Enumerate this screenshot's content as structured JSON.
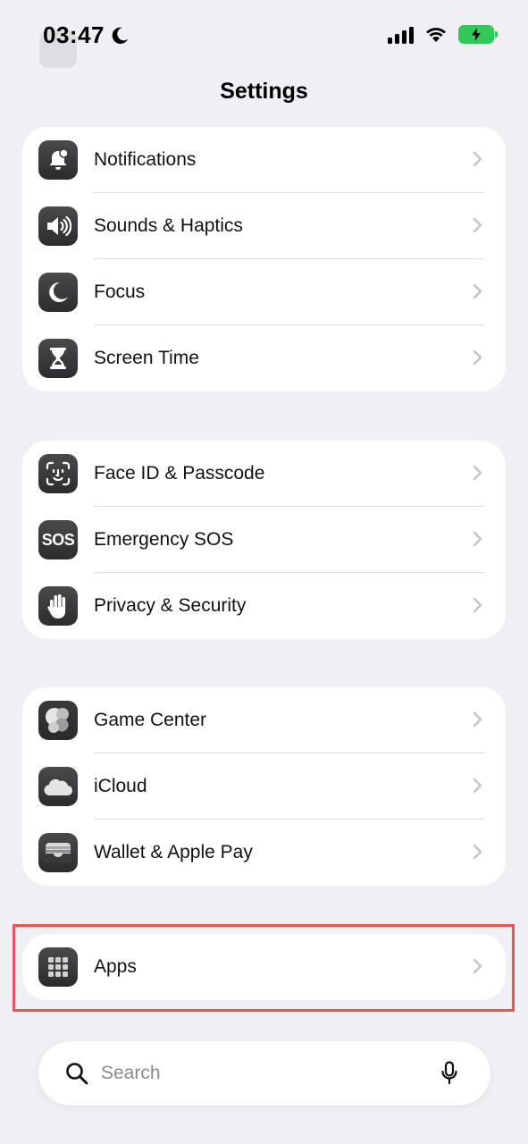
{
  "status_bar": {
    "time": "03:47",
    "icons": [
      "moon-icon",
      "cellular-signal-icon",
      "wifi-icon",
      "battery-charging-icon"
    ],
    "battery_color": "#34c759"
  },
  "header": {
    "title": "Settings"
  },
  "groups": [
    {
      "rows": [
        {
          "label": "Notifications",
          "icon": "notifications-icon"
        },
        {
          "label": "Sounds & Haptics",
          "icon": "speaker-icon"
        },
        {
          "label": "Focus",
          "icon": "moon-icon"
        },
        {
          "label": "Screen Time",
          "icon": "hourglass-icon"
        }
      ]
    },
    {
      "rows": [
        {
          "label": "Face ID & Passcode",
          "icon": "face-id-icon"
        },
        {
          "label": "Emergency SOS",
          "icon": "sos-icon",
          "icon_text": "SOS"
        },
        {
          "label": "Privacy & Security",
          "icon": "hand-icon"
        }
      ]
    },
    {
      "rows": [
        {
          "label": "Game Center",
          "icon": "game-center-icon"
        },
        {
          "label": "iCloud",
          "icon": "cloud-icon"
        },
        {
          "label": "Wallet & Apple Pay",
          "icon": "wallet-icon"
        }
      ]
    },
    {
      "rows": [
        {
          "label": "Apps",
          "icon": "apps-grid-icon"
        }
      ]
    }
  ],
  "search": {
    "placeholder": "Search",
    "icons": [
      "search-icon",
      "microphone-icon"
    ]
  },
  "colors": {
    "background": "#efeff4",
    "highlight": "#e5545a",
    "icon_bg": "#3a3a3c"
  }
}
